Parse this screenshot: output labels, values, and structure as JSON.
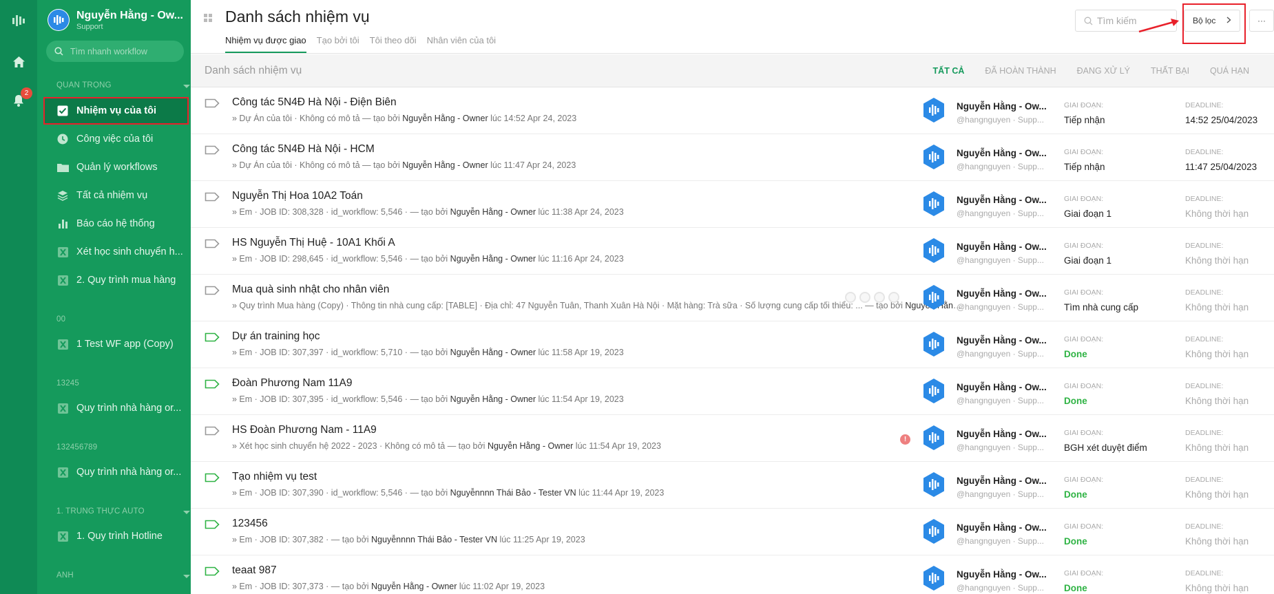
{
  "rail": {
    "notification_count": "2"
  },
  "sidebar": {
    "org_name": "Nguyễn Hằng - Ow...",
    "org_sub": "Support",
    "search_placeholder": "Tìm nhanh workflow",
    "section_important": "QUAN TRỌNG",
    "items_important": [
      {
        "label": "Nhiệm vụ của tôi",
        "icon": "checkbox-icon"
      },
      {
        "label": "Công việc của tôi",
        "icon": "clock-icon"
      },
      {
        "label": "Quản lý workflows",
        "icon": "folder-icon"
      },
      {
        "label": "Tất cả nhiệm vụ",
        "icon": "layers-icon"
      },
      {
        "label": "Báo cáo hệ thống",
        "icon": "bar-chart-icon"
      },
      {
        "label": "Xét học sinh chuyển h...",
        "icon": "workflow-icon"
      },
      {
        "label": "2. Quy trình mua hàng",
        "icon": "workflow-icon"
      }
    ],
    "section_00": "00",
    "item_00": "1 Test WF app (Copy)",
    "section_13245": "13245",
    "item_13245": "Quy trình nhà hàng or...",
    "section_132456789": "132456789",
    "item_132456789": "Quy trình nhà hàng or...",
    "section_auto": "1. TRUNG THỰC AUTO",
    "item_auto": "1. Quy trình Hotline",
    "section_anh": "ANH"
  },
  "header": {
    "title": "Danh sách nhiệm vụ",
    "tabs": [
      "Nhiệm vụ được giao",
      "Tạo bởi tôi",
      "Tôi theo dõi",
      "Nhân viên của tôi"
    ],
    "search_placeholder": "Tìm kiếm",
    "filter_label": "Bộ lọc",
    "more_label": "···"
  },
  "list": {
    "title": "Danh sách nhiệm vụ",
    "status_tabs": [
      "TẤT CẢ",
      "ĐÃ HOÀN THÀNH",
      "ĐANG XỬ LÝ",
      "THẤT BẠI",
      "QUÁ HẠN"
    ],
    "stage_label": "GIAI ĐOẠN:",
    "deadline_label": "DEADLINE:",
    "rows": [
      {
        "title": "Công tác 5N4Đ Hà Nội - Điện Biên",
        "prefix": "» Dự Án của tôi · Không có mô tả — tạo bởi ",
        "creator": "Nguyễn Hằng - Owner",
        "time": " lúc 14:52 Apr 24, 2023",
        "user": "Nguyễn Hằng - Ow...",
        "handle": "@hangnguyen · Supp...",
        "stage": "Tiếp nhận",
        "deadline": "14:52 25/04/2023",
        "tag_color": "#999999"
      },
      {
        "title": "Công tác 5N4Đ Hà Nội - HCM",
        "prefix": "» Dự Án của tôi · Không có mô tả — tạo bởi ",
        "creator": "Nguyễn Hằng - Owner",
        "time": " lúc 11:47 Apr 24, 2023",
        "user": "Nguyễn Hằng - Ow...",
        "handle": "@hangnguyen · Supp...",
        "stage": "Tiếp nhận",
        "deadline": "11:47 25/04/2023",
        "tag_color": "#999999"
      },
      {
        "title": "Nguyễn Thị Hoa 10A2 Toán",
        "prefix": "» Em · JOB ID: 308,328 · id_workflow: 5,546 · — tạo bởi ",
        "creator": "Nguyễn Hằng - Owner",
        "time": " lúc 11:38 Apr 24, 2023",
        "user": "Nguyễn Hằng - Ow...",
        "handle": "@hangnguyen · Supp...",
        "stage": "Giai đoạn 1",
        "deadline": "Không thời hạn",
        "tag_color": "#999999"
      },
      {
        "title": "HS Nguyễn Thị Huệ - 10A1 Khối A",
        "prefix": "» Em · JOB ID: 298,645 · id_workflow: 5,546 · — tạo bởi ",
        "creator": "Nguyễn Hằng - Owner",
        "time": " lúc 11:16 Apr 24, 2023",
        "user": "Nguyễn Hằng - Ow...",
        "handle": "@hangnguyen · Supp...",
        "stage": "Giai đoạn 1",
        "deadline": "Không thời hạn",
        "tag_color": "#999999"
      },
      {
        "title": "Mua quà sinh nhật cho nhân viên",
        "prefix": "» Quy trình Mua hàng (Copy) · Thông tin nhà cung cấp: [TABLE] · Địa chỉ: 47 Nguyễn Tuân, Thanh Xuân Hà Nội · Mặt hàng: Trà sữa · Số lượng cung cấp tối thiểu: ... — tạo bởi ",
        "creator": "Nguyễn Hằng - Owner",
        "time": "",
        "user": "Nguyễn Hằng - Ow...",
        "handle": "@hangnguyen · Supp...",
        "stage": "Tìm nhà cung cấp",
        "deadline": "Không thời hạn",
        "tag_color": "#999999"
      },
      {
        "title": "Dự án training học",
        "prefix": "» Em · JOB ID: 307,397 · id_workflow: 5,710 · — tạo bởi ",
        "creator": "Nguyễn Hằng - Owner",
        "time": " lúc 11:58 Apr 19, 2023",
        "user": "Nguyễn Hằng - Ow...",
        "handle": "@hangnguyen · Supp...",
        "stage": "Done",
        "deadline": "Không thời hạn",
        "tag_color": "#2fb344"
      },
      {
        "title": "Đoàn Phương Nam 11A9",
        "prefix": "» Em · JOB ID: 307,395 · id_workflow: 5,546 · — tạo bởi ",
        "creator": "Nguyễn Hằng - Owner",
        "time": " lúc 11:54 Apr 19, 2023",
        "user": "Nguyễn Hằng - Ow...",
        "handle": "@hangnguyen · Supp...",
        "stage": "Done",
        "deadline": "Không thời hạn",
        "tag_color": "#2fb344"
      },
      {
        "title": "HS Đoàn Phương Nam - 11A9",
        "prefix": "» Xét học sinh chuyển hệ 2022 - 2023 · Không có mô tả — tạo bởi ",
        "creator": "Nguyễn Hằng - Owner",
        "time": " lúc 11:54 Apr 19, 2023",
        "user": "Nguyễn Hằng - Ow...",
        "handle": "@hangnguyen · Supp...",
        "stage": "BGH xét duyệt điểm",
        "deadline": "Không thời hạn",
        "tag_color": "#999999",
        "warning": "!"
      },
      {
        "title": "Tạo nhiệm vụ test",
        "prefix": "» Em · JOB ID: 307,390 · id_workflow: 5,546 · — tạo bởi ",
        "creator": "Nguyễnnnn Thái Bảo - Tester VN",
        "time": " lúc 11:44 Apr 19, 2023",
        "user": "Nguyễn Hằng - Ow...",
        "handle": "@hangnguyen · Supp...",
        "stage": "Done",
        "deadline": "Không thời hạn",
        "tag_color": "#2fb344"
      },
      {
        "title": "123456",
        "prefix": "» Em · JOB ID: 307,382 · — tạo bởi ",
        "creator": "Nguyễnnnn Thái Bảo - Tester VN",
        "time": " lúc 11:25 Apr 19, 2023",
        "user": "Nguyễn Hằng - Ow...",
        "handle": "@hangnguyen · Supp...",
        "stage": "Done",
        "deadline": "Không thời hạn",
        "tag_color": "#2fb344"
      },
      {
        "title": "teaat 987",
        "prefix": "» Em · JOB ID: 307,373 · — tạo bởi ",
        "creator": "Nguyễn Hằng - Owner",
        "time": " lúc 11:02 Apr 19, 2023",
        "user": "Nguyễn Hằng - Ow...",
        "handle": "@hangnguyen · Supp...",
        "stage": "Done",
        "deadline": "Không thời hạn",
        "tag_color": "#2fb344"
      }
    ]
  },
  "colors": {
    "brand": "#159a5c",
    "rail": "#0f8a55",
    "done": "#2fb344",
    "highlight": "#e8202a",
    "avatar": "#2b8ae6"
  }
}
